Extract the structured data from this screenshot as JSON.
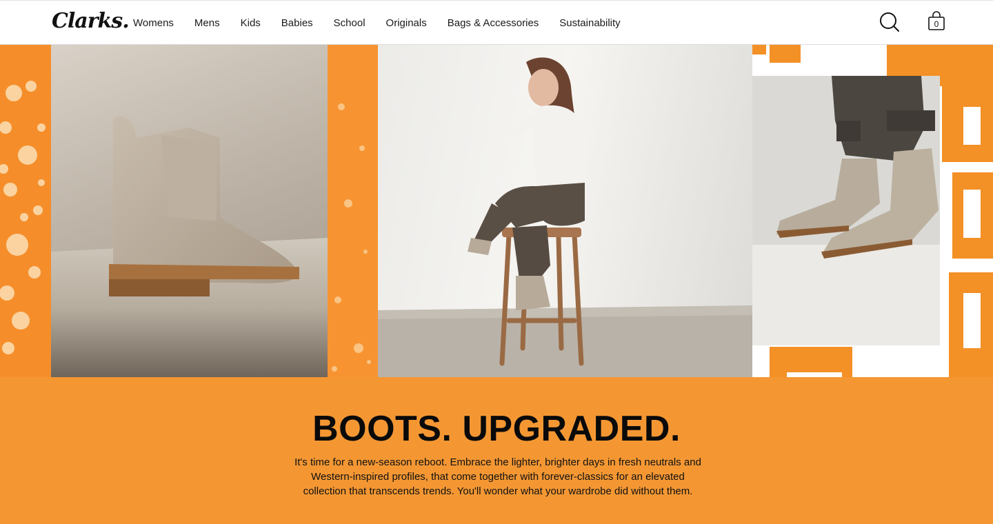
{
  "brand": {
    "logo_text": "Clarks."
  },
  "nav": {
    "items": [
      {
        "label": "Womens"
      },
      {
        "label": "Mens"
      },
      {
        "label": "Kids"
      },
      {
        "label": "Babies"
      },
      {
        "label": "School"
      },
      {
        "label": "Originals"
      },
      {
        "label": "Bags & Accessories"
      },
      {
        "label": "Sustainability"
      }
    ]
  },
  "header_actions": {
    "search_icon": "search-icon",
    "bag_icon": "shopping-bag-icon",
    "bag_count": "0"
  },
  "hero": {
    "images": [
      {
        "depicts": "suede chelsea boot on textured surface"
      },
      {
        "depicts": "model seated on wooden stool wearing chelsea boots"
      },
      {
        "depicts": "close-up of feet wearing chelsea boots"
      }
    ],
    "colors": {
      "accent_orange": "#f58e2a"
    }
  },
  "promo": {
    "title": "BOOTS. UPGRADED.",
    "body": "It's time for a new-season reboot. Embrace the lighter, brighter days in fresh neutrals and Western-inspired profiles, that come together with forever-classics for an elevated collection that transcends trends. You'll wonder what your wardrobe did without them.",
    "background": "#f49733"
  }
}
